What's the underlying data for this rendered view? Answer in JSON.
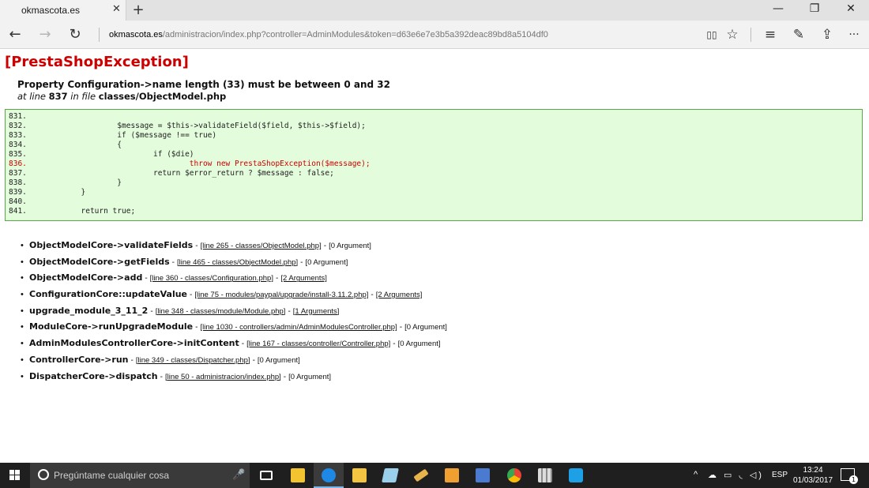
{
  "browser": {
    "tab_title": "okmascota.es",
    "tab_close": "✕",
    "new_tab": "+",
    "url_host": "okmascota.es",
    "url_path": "/administracion/index.php?controller=AdminModules&token=d63e6e7e3b5a392deac89bd8a5104df0",
    "window_controls": {
      "minimize": "—",
      "restore": "❐",
      "close": "✕"
    },
    "nav": {
      "back": "←",
      "forward": "→",
      "refresh": "↻"
    },
    "tools": {
      "reading": "▯▯",
      "favorite": "☆",
      "hub": "≡",
      "note": "✎",
      "share": "⇪",
      "more": "···"
    }
  },
  "page": {
    "exception_title": "[PrestaShopException]",
    "message": "Property Configuration->name length (33) must be between 0 and 32",
    "location": {
      "at_line": "at line",
      "line_no": "837",
      "in_file": "in file",
      "file": "classes/ObjectModel.php"
    },
    "code_lines": [
      {
        "num": "831.",
        "code": ""
      },
      {
        "num": "832.",
        "code": "                    $message = $this->validateField($field, $this->$field);"
      },
      {
        "num": "833.",
        "code": "                    if ($message !== true)"
      },
      {
        "num": "834.",
        "code": "                    {"
      },
      {
        "num": "835.",
        "code": "                            if ($die)"
      },
      {
        "num": "836.",
        "code": "                                    throw new PrestaShopException($message);",
        "highlight": true
      },
      {
        "num": "837.",
        "code": "                            return $error_return ? $message : false;"
      },
      {
        "num": "838.",
        "code": "                    }"
      },
      {
        "num": "839.",
        "code": "            }"
      },
      {
        "num": "840.",
        "code": ""
      },
      {
        "num": "841.",
        "code": "            return true;"
      }
    ],
    "trace": [
      {
        "fn": "ObjectModelCore->validateFields",
        "loc": "[line 265 - classes/ObjectModel.php]",
        "args": "[0 Argument]",
        "args_link": false
      },
      {
        "fn": "ObjectModelCore->getFields",
        "loc": "[line 465 - classes/ObjectModel.php]",
        "args": "[0 Argument]",
        "args_link": false
      },
      {
        "fn": "ObjectModelCore->add",
        "loc": "[line 360 - classes/Configuration.php]",
        "args": "[2 Arguments]",
        "args_link": true
      },
      {
        "fn": "ConfigurationCore::updateValue",
        "loc": "[line 75 - modules/paypal/upgrade/install-3.11.2.php]",
        "args": "[2 Arguments]",
        "args_link": true
      },
      {
        "fn": "upgrade_module_3_11_2",
        "loc": "[line 348 - classes/module/Module.php]",
        "args": "[1 Arguments]",
        "args_link": true
      },
      {
        "fn": "ModuleCore->runUpgradeModule",
        "loc": "[line 1030 - controllers/admin/AdminModulesController.php]",
        "args": "[0 Argument]",
        "args_link": false
      },
      {
        "fn": "AdminModulesControllerCore->initContent",
        "loc": "[line 167 - classes/controller/Controller.php]",
        "args": "[0 Argument]",
        "args_link": false
      },
      {
        "fn": "ControllerCore->run",
        "loc": "[line 349 - classes/Dispatcher.php]",
        "args": "[0 Argument]",
        "args_link": false
      },
      {
        "fn": "DispatcherCore->dispatch",
        "loc": "[line 50 - administracion/index.php]",
        "args": "[0 Argument]",
        "args_link": false
      }
    ]
  },
  "taskbar": {
    "search_placeholder": "Pregúntame cualquier cosa",
    "mic": "🎤",
    "tray_chevron": "^",
    "tray_icons": "☁ ▭ ◟ ◁)",
    "language": "ESP",
    "time": "13:24",
    "date": "01/03/2017",
    "notification_count": "1",
    "app_colors": {
      "task_view": "#ffffff",
      "app1": "#f4c430",
      "edge": "#1e88e5",
      "explorer": "#f5c542",
      "app4": "#9ad0ec",
      "app5": "#e8b44c",
      "app6": "#f0a030",
      "app7": "#4a7bd0",
      "chrome": "#34a853",
      "app9": "#dcdcdc",
      "app10": "#1ea0e6"
    }
  }
}
